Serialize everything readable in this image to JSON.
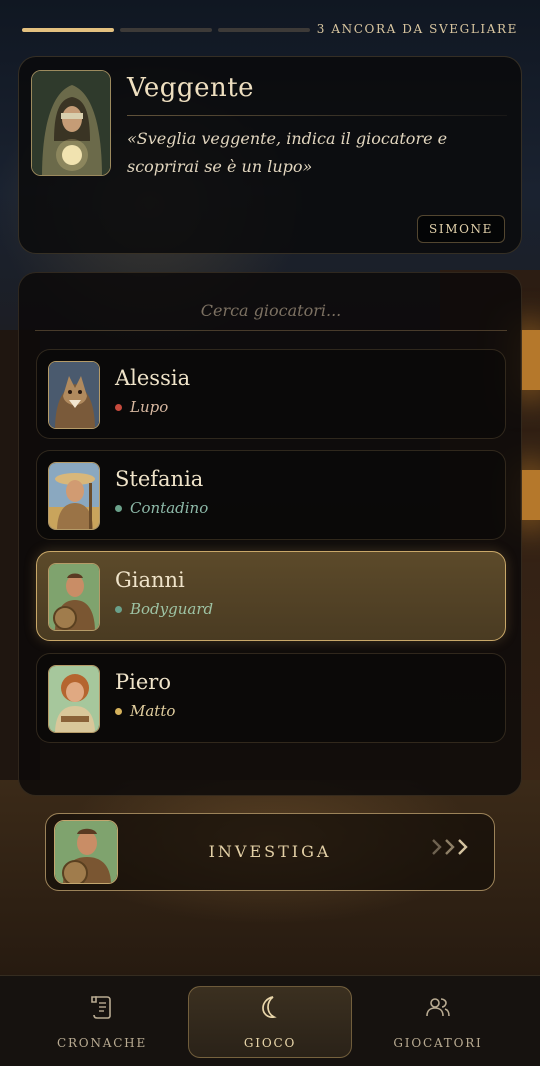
{
  "progress": {
    "segments_total": 3,
    "segments_done": 1,
    "remaining_label": "3 ANCORA DA SVEGLIARE"
  },
  "role": {
    "name": "Veggente",
    "description": "«Sveglia veggente, indica il giocatore e scoprirai se è un lupo»",
    "narrator": "SIMONE",
    "portrait_icon": "hooded-seer-portrait"
  },
  "search": {
    "placeholder": "Cerca giocatori..."
  },
  "players": [
    {
      "name": "Alessia",
      "role": "Lupo",
      "role_color": "#c64a3d",
      "selected": false,
      "avatar_icon": "werewolf-portrait"
    },
    {
      "name": "Stefania",
      "role": "Contadino",
      "role_color": "#6aa18a",
      "selected": false,
      "avatar_icon": "farmer-portrait"
    },
    {
      "name": "Gianni",
      "role": "Bodyguard",
      "role_color": "#6aa18a",
      "selected": true,
      "avatar_icon": "bodyguard-portrait"
    },
    {
      "name": "Piero",
      "role": "Matto",
      "role_color": "#d6b25c",
      "selected": false,
      "avatar_icon": "jester-portrait"
    }
  ],
  "action": {
    "label": "INVESTIGA",
    "chevrons_icon": "triple-chevron-right-icon"
  },
  "nav": [
    {
      "label": "CRONACHE",
      "icon": "scroll-icon",
      "active": false
    },
    {
      "label": "GIOCO",
      "icon": "moon-icon",
      "active": true
    },
    {
      "label": "GIOCATORI",
      "icon": "users-icon",
      "active": false
    }
  ],
  "colors": {
    "accent": "#e3c07f",
    "selected_border": "#c9a869"
  }
}
